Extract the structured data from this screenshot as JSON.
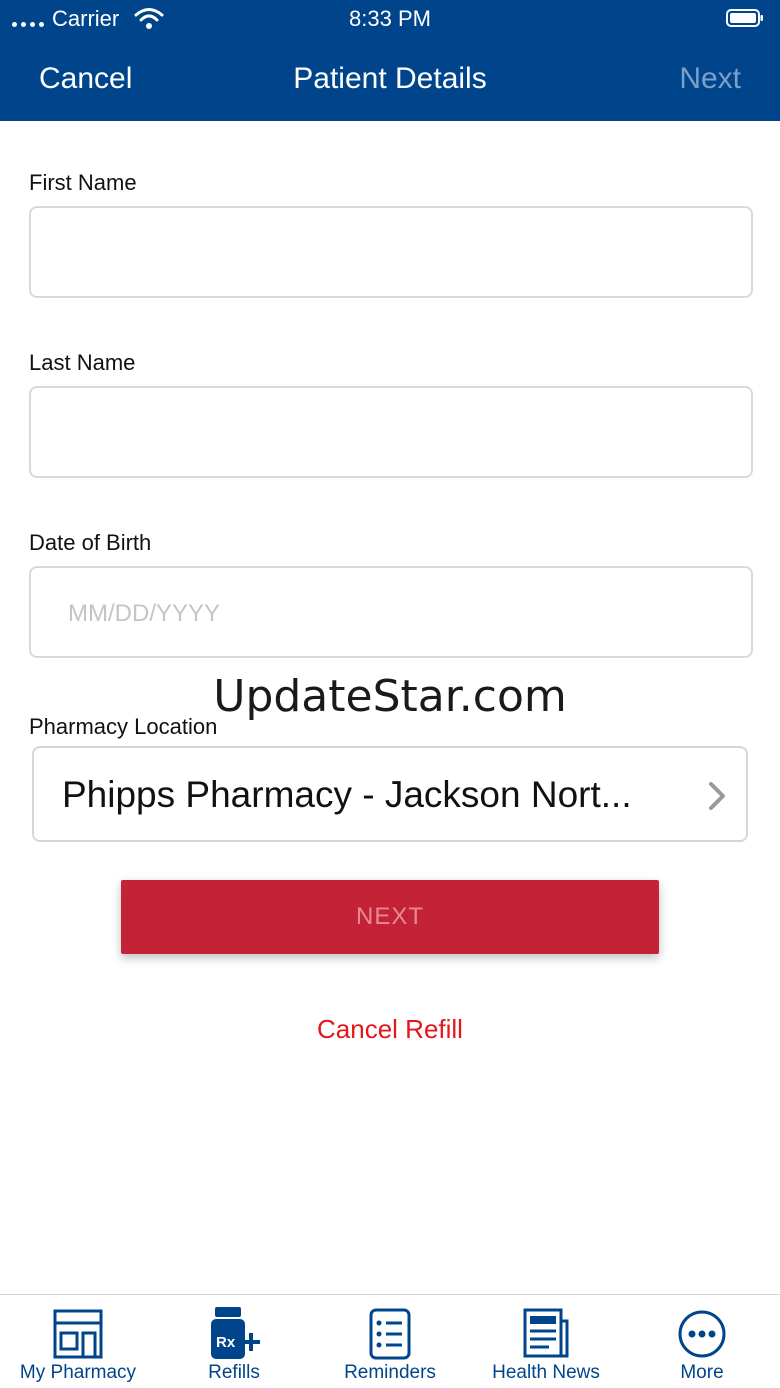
{
  "status_bar": {
    "carrier": "Carrier",
    "time": "8:33 PM"
  },
  "nav": {
    "cancel_label": "Cancel",
    "title": "Patient Details",
    "next_label": "Next"
  },
  "form": {
    "first_name": {
      "label": "First Name",
      "value": "",
      "placeholder": ""
    },
    "last_name": {
      "label": "Last Name",
      "value": "",
      "placeholder": ""
    },
    "dob": {
      "label": "Date of Birth",
      "value": "",
      "placeholder": "MM/DD/YYYY"
    },
    "pharmacy_location": {
      "label": "Pharmacy Location",
      "value": "Phipps Pharmacy - Jackson Nort..."
    }
  },
  "watermark": "UpdateStar.com",
  "actions": {
    "next_label": "NEXT",
    "cancel_refill_label": "Cancel Refill"
  },
  "tabbar": {
    "items": [
      {
        "label": "My Pharmacy",
        "icon": "storefront-icon"
      },
      {
        "label": "Refills",
        "icon": "rx-plus-icon"
      },
      {
        "label": "Reminders",
        "icon": "checklist-icon"
      },
      {
        "label": "Health News",
        "icon": "newspaper-icon"
      },
      {
        "label": "More",
        "icon": "more-dots-icon"
      }
    ]
  },
  "colors": {
    "header": "#00458b",
    "primary_button": "#c42236",
    "cancel_text": "#e4161c",
    "tab_text": "#00458b"
  }
}
